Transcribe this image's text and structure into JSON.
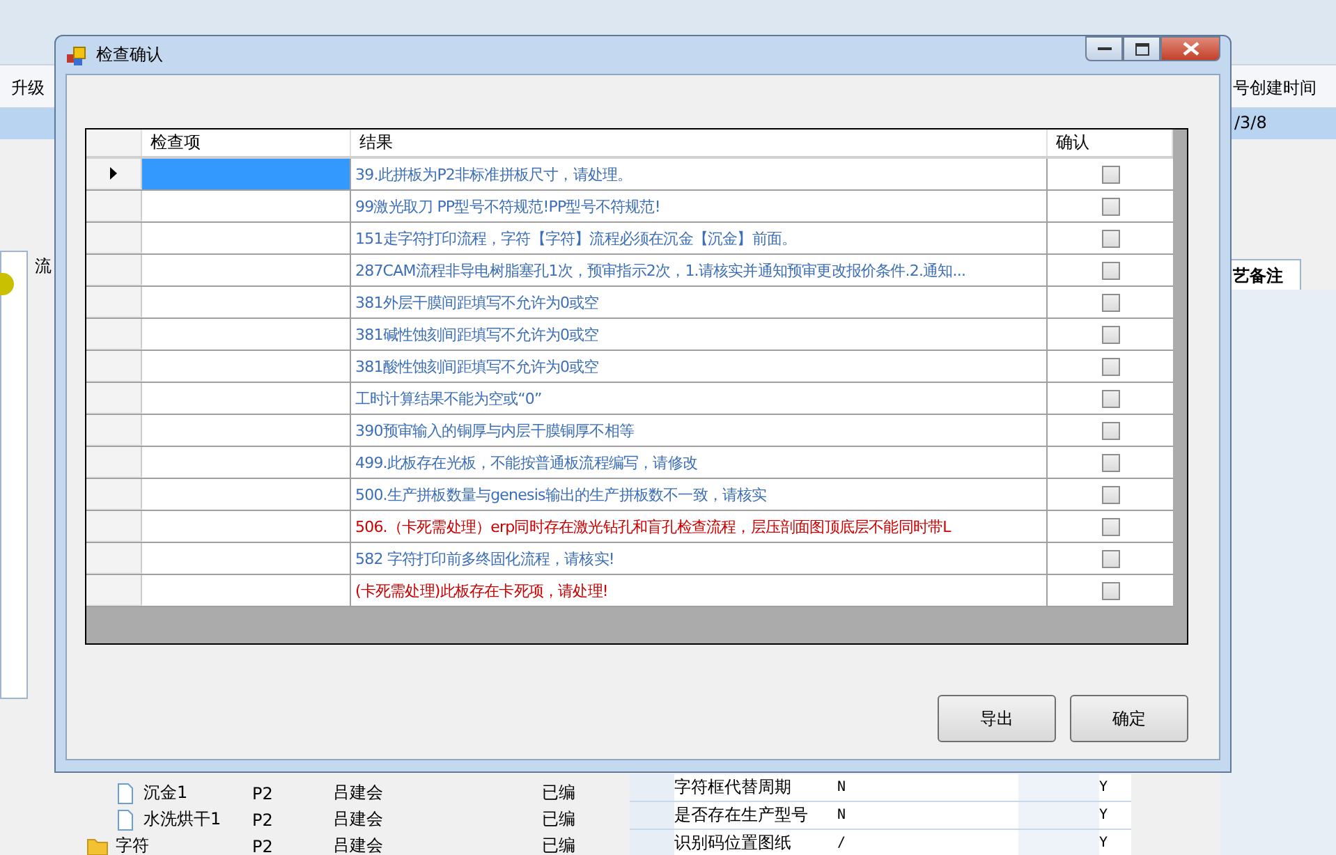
{
  "background_window": {
    "header_left": "升级",
    "header_right": "号创建时间",
    "row_value": "/3/8",
    "panel_label": "流",
    "tab_label": "艺备注",
    "tree_rows": [
      {
        "kind": "file",
        "name": "沉金1",
        "layer": "P2",
        "author": "吕建会",
        "status": "已编"
      },
      {
        "kind": "file",
        "name": "水洗烘干1",
        "layer": "P2",
        "author": "吕建会",
        "status": "已编"
      },
      {
        "kind": "folder",
        "name": "字符",
        "layer": "P2",
        "author": "吕建会",
        "status": "已编"
      }
    ],
    "properties": [
      {
        "name": "字符框代替周期",
        "value": "N",
        "flag": "Y"
      },
      {
        "name": "是否存在生产型号",
        "value": "N",
        "flag": "Y"
      },
      {
        "name": "识别码位置图纸",
        "value": "/",
        "flag": "Y"
      }
    ]
  },
  "dialog": {
    "title": "检查确认",
    "table": {
      "columns": [
        "检查项",
        "结果",
        "确认"
      ],
      "rows": [
        {
          "selected": true,
          "result": "39.此拼板为P2非标准拼板尺寸，请处理。",
          "color": "#3d6fb8",
          "checked": false
        },
        {
          "selected": false,
          "result": "99激光取刀 PP型号不符规范!PP型号不符规范!",
          "color": "#3d6fb8",
          "checked": false
        },
        {
          "selected": false,
          "result": "151走字符打印流程，字符【字符】流程必须在沉金【沉金】前面。",
          "color": "#3d6fb8",
          "checked": false
        },
        {
          "selected": false,
          "result": "287CAM流程非导电树脂塞孔1次，预审指示2次，1.请核实并通知预审更改报价条件.2.通知...",
          "color": "#3d6fb8",
          "checked": false
        },
        {
          "selected": false,
          "result": "381外层干膜间距填写不允许为0或空",
          "color": "#3d6fb8",
          "checked": false
        },
        {
          "selected": false,
          "result": "381碱性蚀刻间距填写不允许为0或空",
          "color": "#3d6fb8",
          "checked": false
        },
        {
          "selected": false,
          "result": "381酸性蚀刻间距填写不允许为0或空",
          "color": "#3d6fb8",
          "checked": false
        },
        {
          "selected": false,
          "result": "工时计算结果不能为空或“0”",
          "color": "#3d6fb8",
          "checked": false
        },
        {
          "selected": false,
          "result": "390预审输入的铜厚与内层干膜铜厚不相等",
          "color": "#3d6fb8",
          "checked": false
        },
        {
          "selected": false,
          "result": "499.此板存在光板，不能按普通板流程编写，请修改",
          "color": "#3d6fb8",
          "checked": false
        },
        {
          "selected": false,
          "result": "500.生产拼板数量与genesis输出的生产拼板数不一致，请核实",
          "color": "#3d6fb8",
          "checked": false
        },
        {
          "selected": false,
          "result": "506.（卡死需处理）erp同时存在激光钻孔和盲孔检查流程，层压剖面图顶底层不能同时带L",
          "color": "#cc0000",
          "checked": false
        },
        {
          "selected": false,
          "result": "582 字符打印前多终固化流程，请核实!",
          "color": "#3d6fb8",
          "checked": false
        },
        {
          "selected": false,
          "result": "(卡死需处理)此板存在卡死项，请处理!",
          "color": "#cc0000",
          "checked": false
        }
      ]
    },
    "buttons": [
      "导出",
      "确定"
    ]
  }
}
